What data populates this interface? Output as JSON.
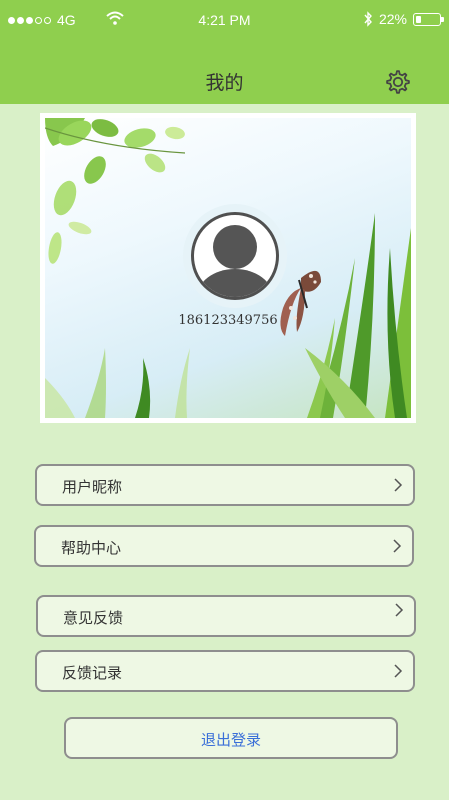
{
  "status_bar": {
    "carrier": "4G",
    "time": "4:21 PM",
    "battery": "22%",
    "battery_level": 0.22
  },
  "header": {
    "title": "我的"
  },
  "profile": {
    "phone": "186123349756"
  },
  "menu": {
    "items": [
      {
        "label": "用户昵称"
      },
      {
        "label": "帮助中心"
      },
      {
        "label": "意见反馈"
      },
      {
        "label": "反馈记录"
      }
    ]
  },
  "logout": {
    "label": "退出登录"
  },
  "colors": {
    "header": "#8fcf4e",
    "background": "#d9f0c8",
    "button_fill": "#eef8e4",
    "logout_text": "#3a6fd8"
  }
}
